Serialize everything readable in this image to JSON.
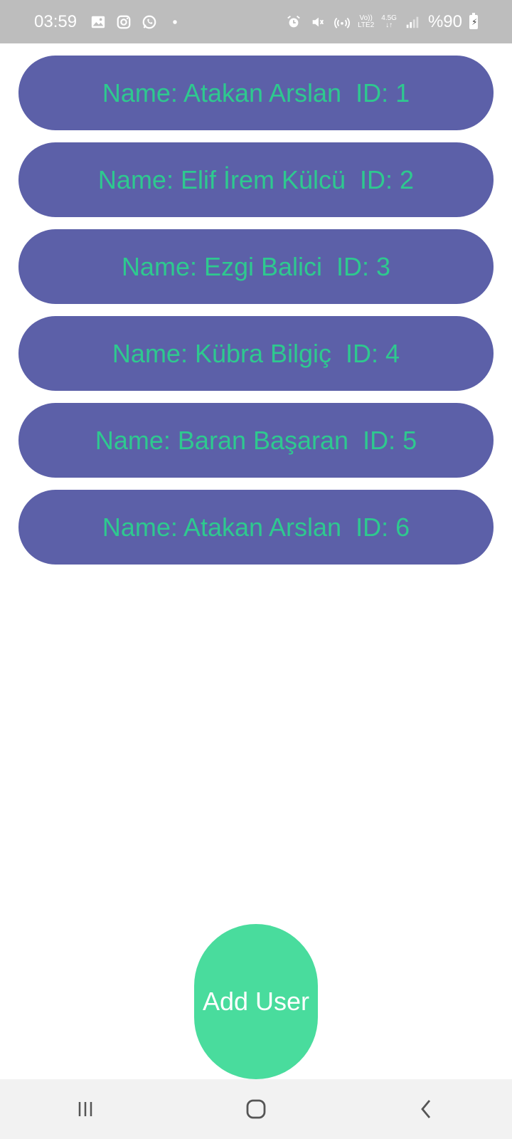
{
  "status_bar": {
    "time": "03:59",
    "net_top": "Vo))",
    "net_bottom": "LTE2",
    "signal_top": "4.5G",
    "signal_bottom": "↓↑",
    "battery": "%90",
    "icons": [
      "image-icon",
      "instagram-icon",
      "whatsapp-icon",
      "dot-icon",
      "alarm-icon",
      "mute-icon",
      "hotspot-icon",
      "signal-icon",
      "battery-icon"
    ]
  },
  "users": [
    {
      "label": "Name: Atakan Arslan  ID: 1"
    },
    {
      "label": "Name: Elif İrem Külcü  ID: 2"
    },
    {
      "label": "Name: Ezgi Balici  ID: 3"
    },
    {
      "label": "Name: Kübra Bilgiç  ID: 4"
    },
    {
      "label": "Name: Baran Başaran  ID: 5"
    },
    {
      "label": "Name: Atakan Arslan  ID: 6"
    }
  ],
  "add_user_label": "Add User",
  "colors": {
    "item_bg": "#5c60a8",
    "item_text": "#2ec98f",
    "button_bg": "#49dc9d",
    "status_bg": "#bdbdbd"
  },
  "nav": [
    "recent-apps-icon",
    "home-icon",
    "back-icon"
  ]
}
